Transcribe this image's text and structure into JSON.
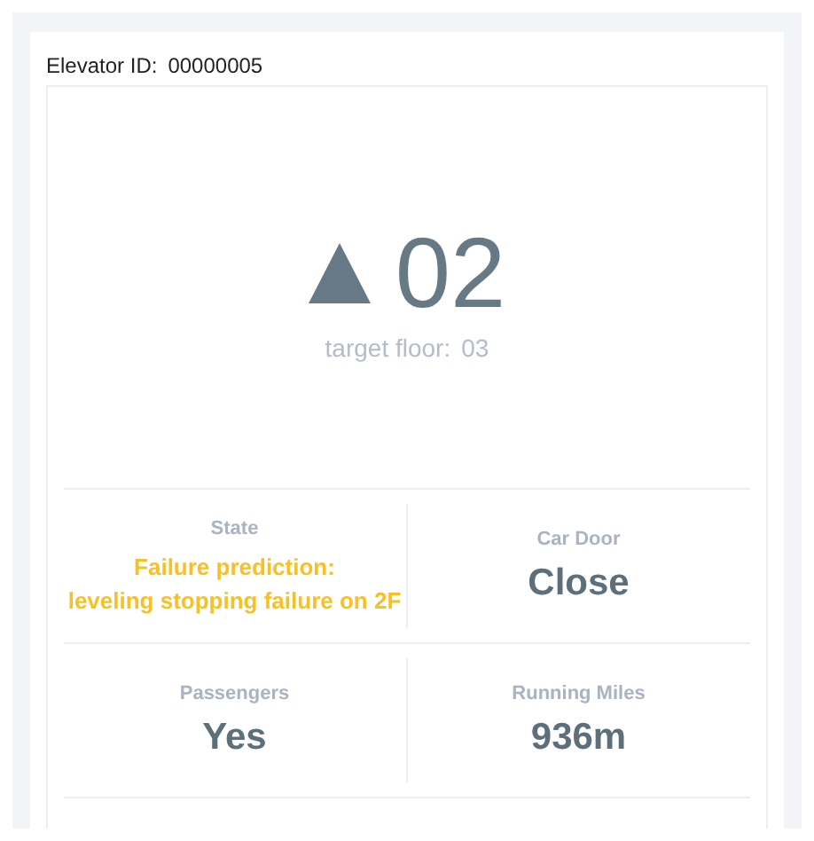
{
  "elevator_id_label": "Elevator ID:",
  "elevator_id": "00000005",
  "direction_arrow": {
    "kind": "up"
  },
  "current_floor": "02",
  "target_floor_label": "target floor:",
  "target_floor": "03",
  "stats": [
    {
      "label": "State",
      "value": "Failure prediction:\nleveling stopping failure on 2F",
      "kind": "warning"
    },
    {
      "label": "Car Door",
      "value": "Close",
      "kind": "normal"
    },
    {
      "label": "Passengers",
      "value": "Yes",
      "kind": "normal"
    },
    {
      "label": "Running Miles",
      "value": "936m",
      "kind": "normal"
    }
  ]
}
